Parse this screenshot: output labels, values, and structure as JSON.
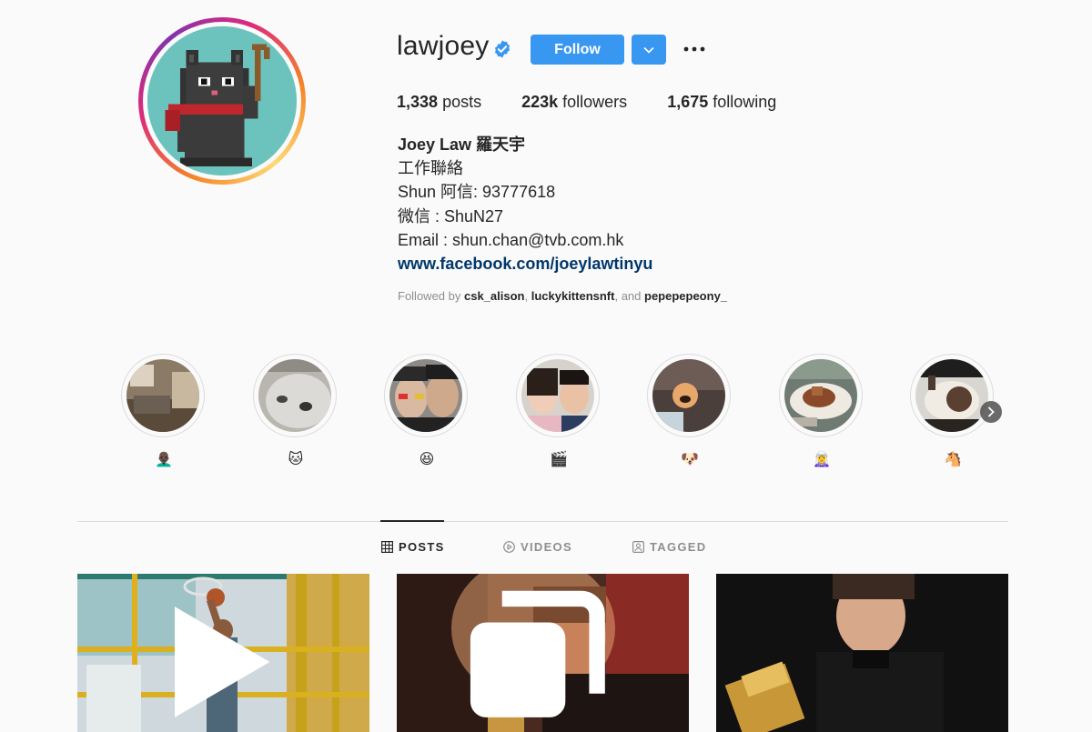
{
  "profile": {
    "username": "lawjoey",
    "verified": true,
    "follow_label": "Follow",
    "stats": [
      {
        "count": "1,338",
        "label": "posts"
      },
      {
        "count": "223k",
        "label": "followers"
      },
      {
        "count": "1,675",
        "label": "following"
      }
    ],
    "bio": {
      "name": "Joey Law 羅天宇",
      "lines": [
        "工作聯絡",
        "Shun 阿信: 93777618",
        "微信 : ShuN27",
        "Email : shun.chan@tvb.com.hk"
      ],
      "link": "www.facebook.com/joeylawtinyu"
    },
    "followed_by": {
      "prefix": "Followed by ",
      "users": [
        "csk_alison",
        "luckykittensnft",
        "pepepepeony_"
      ],
      "sep1": ", ",
      "sep2": ", and "
    }
  },
  "highlights": [
    {
      "label": "👨🏿‍🦲"
    },
    {
      "label": "🐱"
    },
    {
      "label": "😆"
    },
    {
      "label": "🎬"
    },
    {
      "label": "🐶"
    },
    {
      "label": "🧝‍♀️"
    },
    {
      "label": "🐴"
    }
  ],
  "tabs": [
    {
      "label": "POSTS",
      "icon": "grid-icon",
      "active": true
    },
    {
      "label": "VIDEOS",
      "icon": "play-circle-icon",
      "active": false
    },
    {
      "label": "TAGGED",
      "icon": "tag-user-icon",
      "active": false
    }
  ],
  "colors": {
    "accent": "#3897f0",
    "link": "#00376b",
    "muted": "#8e8e8e",
    "text": "#262626"
  }
}
